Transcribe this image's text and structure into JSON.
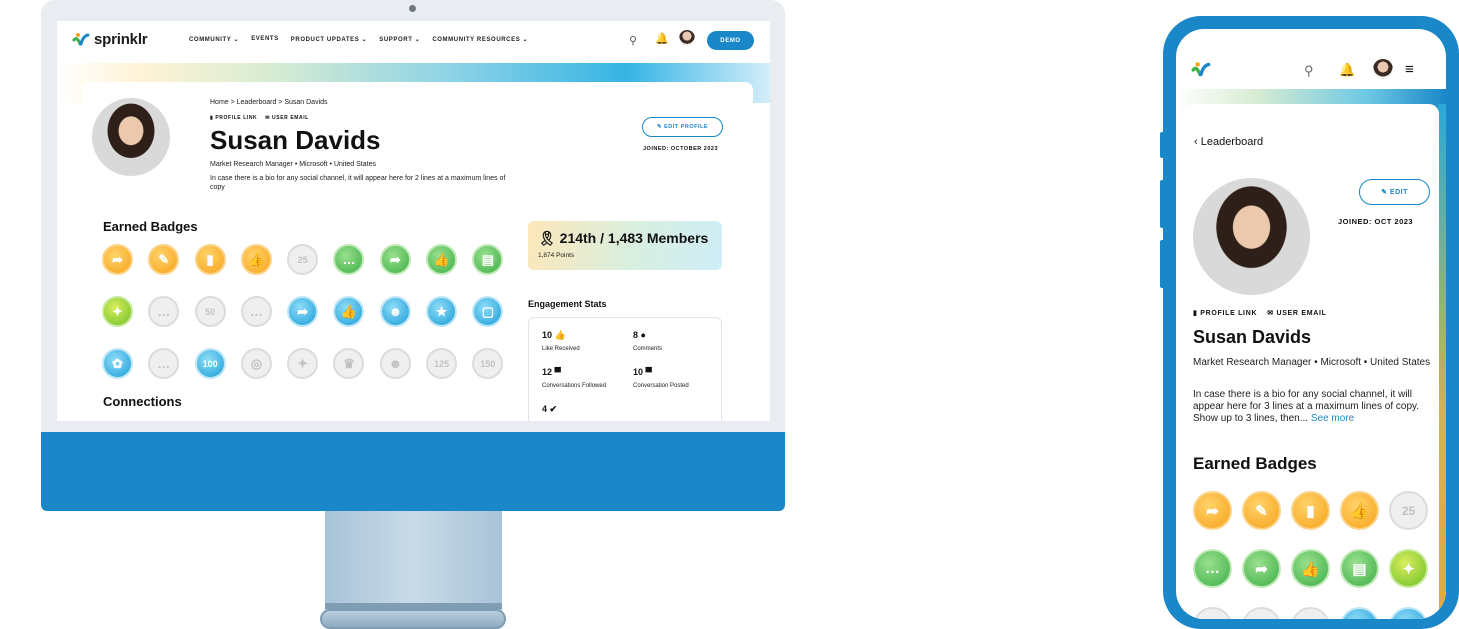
{
  "desktop": {
    "brand": "sprinklr",
    "nav": [
      "COMMUNITY ⌄",
      "EVENTS",
      "PRODUCT UPDATES ⌄",
      "SUPPORT ⌄",
      "COMMUNITY RESOURCES ⌄"
    ],
    "demo_label": "DEMO",
    "breadcrumb": "Home > Leaderboard > Susan Davids",
    "profile_link": "PROFILE LINK",
    "user_email": "USER EMAIL",
    "name": "Susan Davids",
    "role": "Market Research Manager • Microsoft • United States",
    "bio": "In case there is a bio for any social channel, it will appear here for 2 lines at a maximum lines of copy",
    "edit_label": "✎ EDIT PROFILE",
    "joined": "JOINED: OCTOBER 2023",
    "badges_title": "Earned Badges",
    "badges": [
      {
        "style": "orange",
        "icon": "➦"
      },
      {
        "style": "orange",
        "icon": "✎"
      },
      {
        "style": "orange",
        "icon": "▮"
      },
      {
        "style": "orange",
        "icon": "👍"
      },
      {
        "style": "gray",
        "icon": "25"
      },
      {
        "style": "green",
        "icon": "…"
      },
      {
        "style": "green",
        "icon": "➦"
      },
      {
        "style": "green",
        "icon": "👍"
      },
      {
        "style": "green",
        "icon": "▤"
      },
      {
        "style": "lime",
        "icon": "✦"
      },
      {
        "style": "gray",
        "icon": "…"
      },
      {
        "style": "gray",
        "icon": "50"
      },
      {
        "style": "gray",
        "icon": "…"
      },
      {
        "style": "blue",
        "icon": "➦"
      },
      {
        "style": "blue",
        "icon": "👍"
      },
      {
        "style": "blue",
        "icon": "☻"
      },
      {
        "style": "blue",
        "icon": "★"
      },
      {
        "style": "blue",
        "icon": "▢"
      },
      {
        "style": "blue",
        "icon": "✿"
      },
      {
        "style": "gray",
        "icon": "…"
      },
      {
        "style": "blue",
        "icon": "100"
      },
      {
        "style": "gray",
        "icon": "◎"
      },
      {
        "style": "gray",
        "icon": "✦"
      },
      {
        "style": "gray",
        "icon": "♛"
      },
      {
        "style": "gray",
        "icon": "☻"
      },
      {
        "style": "gray",
        "icon": "125"
      },
      {
        "style": "gray",
        "icon": "150"
      }
    ],
    "rank": "🎗 214th / 1,483 Members",
    "points": "1,874 Points",
    "engagement_title": "Engagement Stats",
    "stats": [
      {
        "value": "10 👍",
        "label": "Like Received"
      },
      {
        "value": "8 ●",
        "label": "Comments"
      },
      {
        "value": "12 ▀",
        "label": "Conversations Followed"
      },
      {
        "value": "10 ▀",
        "label": "Conversation Posted"
      },
      {
        "value": "4 ✔",
        "label": ""
      }
    ],
    "connections_title": "Connections"
  },
  "mobile": {
    "back_label": "‹  Leaderboard",
    "edit_label": "✎ EDIT",
    "joined": "JOINED: OCT 2023",
    "profile_link": "PROFILE LINK",
    "user_email": "USER EMAIL",
    "name": "Susan Davids",
    "role": "Market Research Manager • Microsoft • United States",
    "bio": "In case there is a bio for any social channel, it will appear here for 3 lines at a maximum lines of copy. Show up to 3 lines, then...",
    "see_more": "See more",
    "badges_title": "Earned Badges",
    "badges": [
      {
        "style": "orange",
        "icon": "➦"
      },
      {
        "style": "orange",
        "icon": "✎"
      },
      {
        "style": "orange",
        "icon": "▮"
      },
      {
        "style": "orange",
        "icon": "👍"
      },
      {
        "style": "gray",
        "icon": "25"
      },
      {
        "style": "green",
        "icon": "…"
      },
      {
        "style": "green",
        "icon": "➦"
      },
      {
        "style": "green",
        "icon": "👍"
      },
      {
        "style": "green",
        "icon": "▤"
      },
      {
        "style": "lime",
        "icon": "✦"
      },
      {
        "style": "gray",
        "icon": ""
      },
      {
        "style": "gray",
        "icon": ""
      },
      {
        "style": "gray",
        "icon": ""
      },
      {
        "style": "blue",
        "icon": ""
      },
      {
        "style": "blue",
        "icon": ""
      }
    ]
  },
  "colors": {
    "accent": "#1a87c9",
    "orange": "#f7a21a",
    "green": "#3cae45",
    "blue": "#1a9ed8"
  }
}
